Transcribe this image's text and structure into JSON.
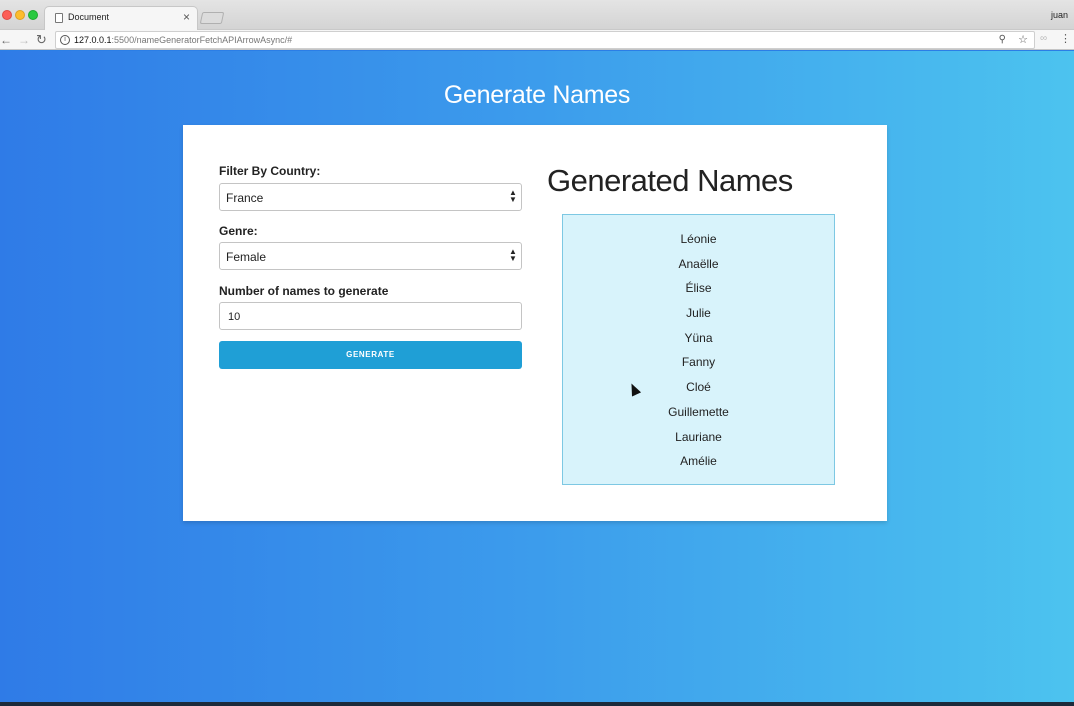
{
  "browser": {
    "tab_title": "Document",
    "tab_close": "×",
    "user_name": "juan",
    "url_host": "127.0.0.1",
    "url_rest": ":5500/nameGeneratorFetchAPIArrowAsync/#",
    "icons": {
      "back": "arrow-left-icon",
      "forward": "arrow-right-icon",
      "reload": "reload-icon",
      "info": "info-icon",
      "zoom": "zoom-icon",
      "bookmark": "star-icon",
      "menu": "kebab-menu-icon"
    }
  },
  "page": {
    "title": "Generate Names"
  },
  "form": {
    "country_label": "Filter By Country:",
    "country_value": "France",
    "genre_label": "Genre:",
    "genre_value": "Female",
    "number_label": "Number of names to generate",
    "number_value": "10",
    "generate_label": "GENERATE"
  },
  "results": {
    "title": "Generated Names",
    "names": [
      "Léonie",
      "Anaëlle",
      "Élise",
      "Julie",
      "Yüna",
      "Fanny",
      "Cloé",
      "Guillemette",
      "Lauriane",
      "Amélie"
    ]
  },
  "colors": {
    "button": "#1f9fd6",
    "results_bg": "#d8f3fb",
    "results_border": "#7dc8e3",
    "gradient_left": "#2f7be7",
    "gradient_right": "#4cc3ef"
  }
}
